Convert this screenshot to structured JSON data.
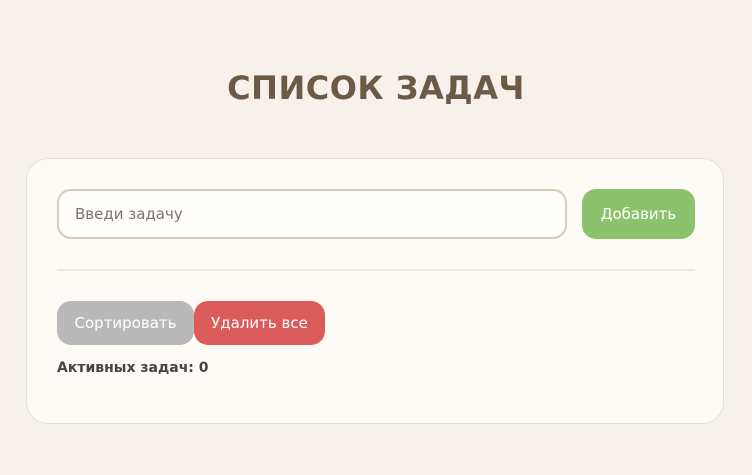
{
  "header": {
    "title": "СПИСОК ЗАДАЧ"
  },
  "form": {
    "input_value": "",
    "input_placeholder": "Введи задачу",
    "add_label": "Добавить"
  },
  "actions": {
    "sort_label": "Сортировать",
    "clear_label": "Удалить все"
  },
  "status": {
    "active_label": "Активных задач:",
    "active_count": "0"
  },
  "colors": {
    "title": "#6b5b45",
    "add_button": "#8cc26c",
    "sort_button": "#b9b9b9",
    "clear_button": "#db5b5b"
  }
}
